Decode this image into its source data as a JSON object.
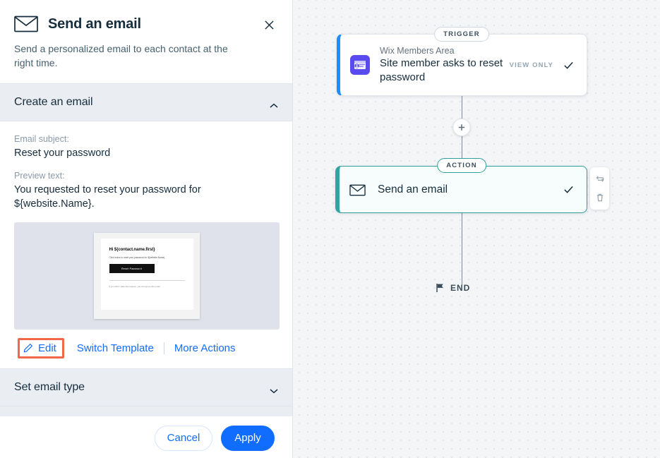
{
  "panel": {
    "icon": "envelope-icon",
    "title": "Send an email",
    "subtitle": "Send a personalized email to each contact at the right time.",
    "close_icon": "close-icon",
    "sections": [
      {
        "id": "create-an-email",
        "label": "Create an email",
        "chevron": "chevron-up-icon",
        "expanded": true
      },
      {
        "id": "set-email-type",
        "label": "Set email type",
        "chevron": "chevron-down-icon",
        "expanded": false
      }
    ],
    "fields": [
      {
        "label": "Email subject:",
        "value": "Reset your password"
      },
      {
        "label": "Preview text:",
        "value": "You requested to reset your password for ${website.Name}."
      }
    ],
    "email_preview": {
      "heading": "Hi ${contact.name.first}",
      "body": "Click below to reset your password for ${website.Name}.",
      "button_label": "Reset Password",
      "footer": "If you didn't make this request, you can ignore this email."
    },
    "actions": [
      {
        "id": "edit",
        "label": "Edit",
        "icon": "pencil-icon",
        "highlighted": true
      },
      {
        "id": "switch-template",
        "label": "Switch Template",
        "icon": null,
        "highlighted": false
      },
      {
        "id": "more-actions",
        "label": "More Actions",
        "icon": null,
        "highlighted": false
      }
    ],
    "footer": {
      "cancel_label": "Cancel",
      "apply_label": "Apply"
    }
  },
  "canvas": {
    "trigger": {
      "badge": "TRIGGER",
      "app_name": "Wix Members Area",
      "title": "Site member asks to reset password",
      "status": "VIEW ONLY",
      "check_icon": "check-icon",
      "app_icon": "members-area-icon",
      "accent_color": "#1e8ffa"
    },
    "add_step": {
      "icon": "plus-icon"
    },
    "action": {
      "badge": "ACTION",
      "icon": "envelope-icon",
      "title": "Send an email",
      "check_icon": "check-icon",
      "accent_color": "#32a4a4"
    },
    "tools": [
      {
        "id": "replace",
        "icon": "swap-arrows-icon"
      },
      {
        "id": "delete",
        "icon": "trash-icon"
      }
    ],
    "end": {
      "icon": "flag-icon",
      "label": "END"
    },
    "cursor": "pointer-hand-cursor"
  },
  "colors": {
    "primary_blue": "#116dff",
    "trigger_accent": "#1e8ffa",
    "action_accent": "#32a4a4",
    "highlight_orange": "#f4664a",
    "canvas_bg": "#f4f5f7"
  }
}
